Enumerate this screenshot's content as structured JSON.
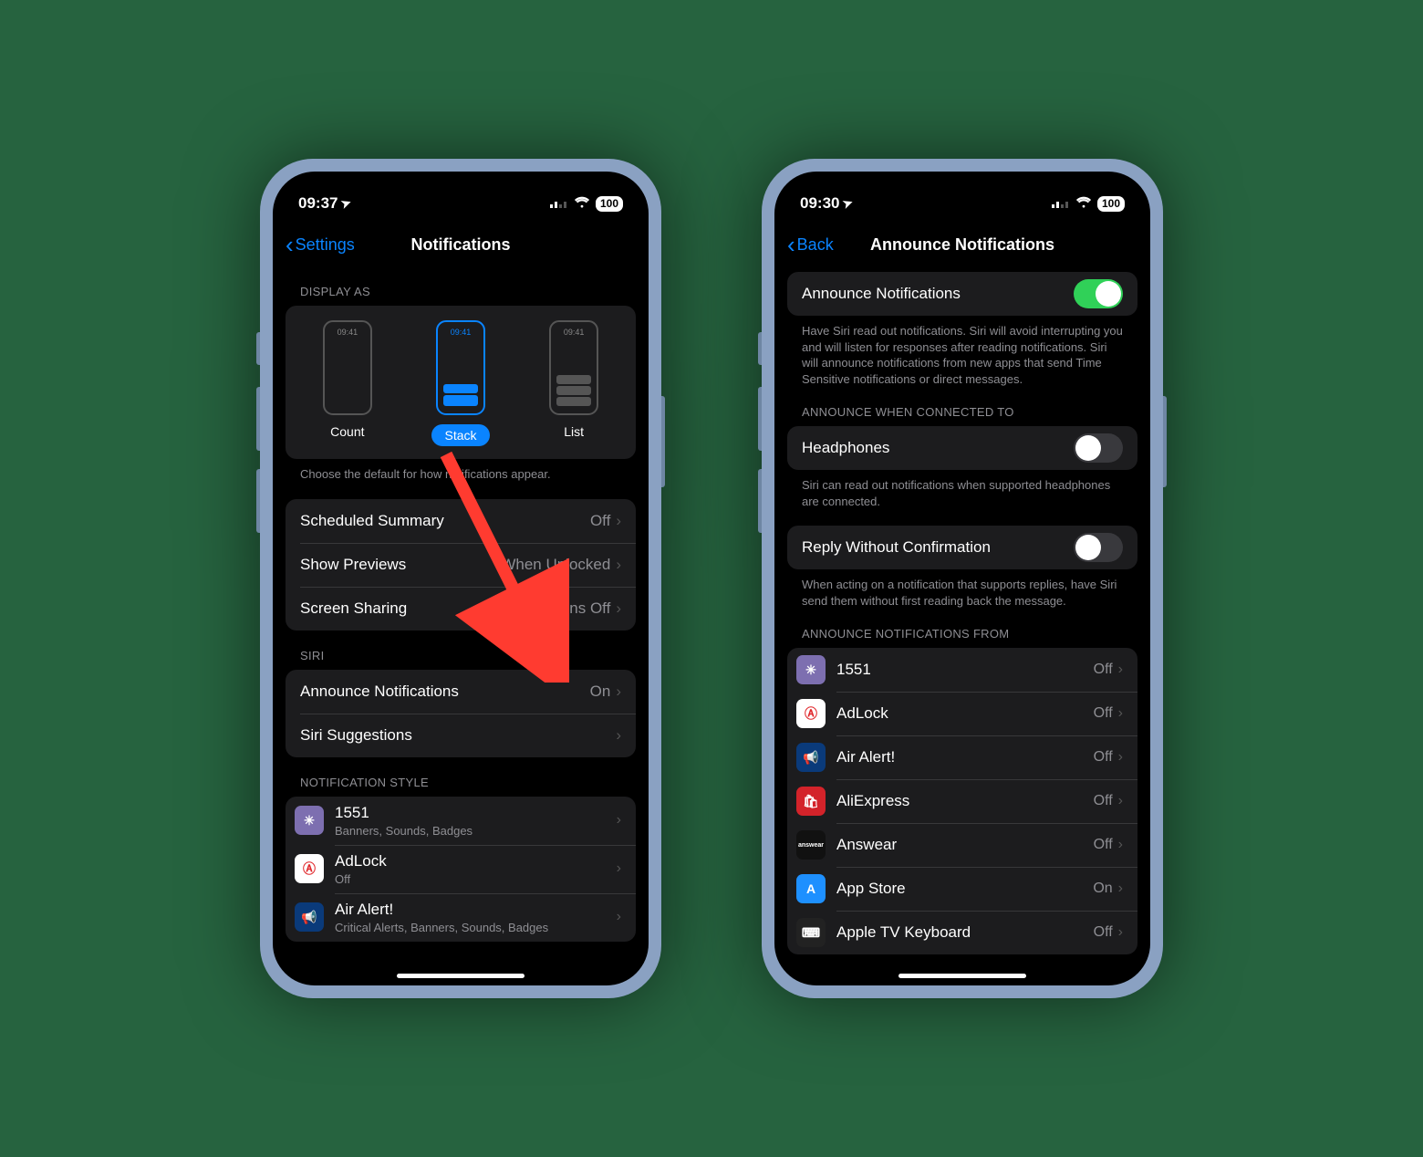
{
  "left": {
    "status": {
      "time": "09:37",
      "loc_icon": "➤",
      "battery": "100"
    },
    "nav": {
      "back": "Settings",
      "title": "Notifications"
    },
    "display_as": {
      "header": "DISPLAY AS",
      "modes": {
        "count": "Count",
        "stack": "Stack",
        "list": "List"
      },
      "mini_time": "09:41",
      "footer": "Choose the default for how notifications appear."
    },
    "rows1": {
      "scheduled": {
        "label": "Scheduled Summary",
        "val": "Off"
      },
      "previews": {
        "label": "Show Previews",
        "val": "When Unlocked"
      },
      "sharing": {
        "label": "Screen Sharing",
        "val": "Notifications Off"
      }
    },
    "siri": {
      "header": "SIRI",
      "announce": {
        "label": "Announce Notifications",
        "val": "On"
      },
      "suggest": {
        "label": "Siri Suggestions"
      }
    },
    "style": {
      "header": "NOTIFICATION STYLE",
      "apps": [
        {
          "name": "1551",
          "sub": "Banners, Sounds, Badges"
        },
        {
          "name": "AdLock",
          "sub": "Off"
        },
        {
          "name": "Air Alert!",
          "sub": "Critical Alerts, Banners, Sounds, Badges"
        }
      ]
    }
  },
  "right": {
    "status": {
      "time": "09:30",
      "loc_icon": "➤",
      "battery": "100"
    },
    "nav": {
      "back": "Back",
      "title": "Announce Notifications"
    },
    "main_toggle": {
      "label": "Announce Notifications",
      "on": true,
      "footer": "Have Siri read out notifications. Siri will avoid interrupting you and will listen for responses after reading notifications. Siri will announce notifications from new apps that send Time Sensitive notifications or direct messages."
    },
    "connect": {
      "header": "ANNOUNCE WHEN CONNECTED TO",
      "headphones": {
        "label": "Headphones",
        "on": false
      },
      "footer": "Siri can read out notifications when supported headphones are connected."
    },
    "reply": {
      "label": "Reply Without Confirmation",
      "on": false,
      "footer": "When acting on a notification that supports replies, have Siri send them without first reading back the message."
    },
    "from": {
      "header": "ANNOUNCE NOTIFICATIONS FROM",
      "apps": [
        {
          "name": "1551",
          "val": "Off",
          "bg": "#7d6fb0",
          "glyph": "✳"
        },
        {
          "name": "AdLock",
          "val": "Off",
          "bg": "#ffffff",
          "glyph": "Ⓐ",
          "fg": "#e0262a"
        },
        {
          "name": "Air Alert!",
          "val": "Off",
          "bg": "#0a3a7a",
          "glyph": "📢"
        },
        {
          "name": "AliExpress",
          "val": "Off",
          "bg": "#d3232a",
          "glyph": "🛍"
        },
        {
          "name": "Answear",
          "val": "Off",
          "bg": "#111111",
          "glyph": "a",
          "txt": "answear"
        },
        {
          "name": "App Store",
          "val": "On",
          "bg": "#1e90ff",
          "glyph": "A"
        },
        {
          "name": "Apple TV Keyboard",
          "val": "Off",
          "bg": "#222222",
          "glyph": "⌨"
        }
      ]
    }
  }
}
